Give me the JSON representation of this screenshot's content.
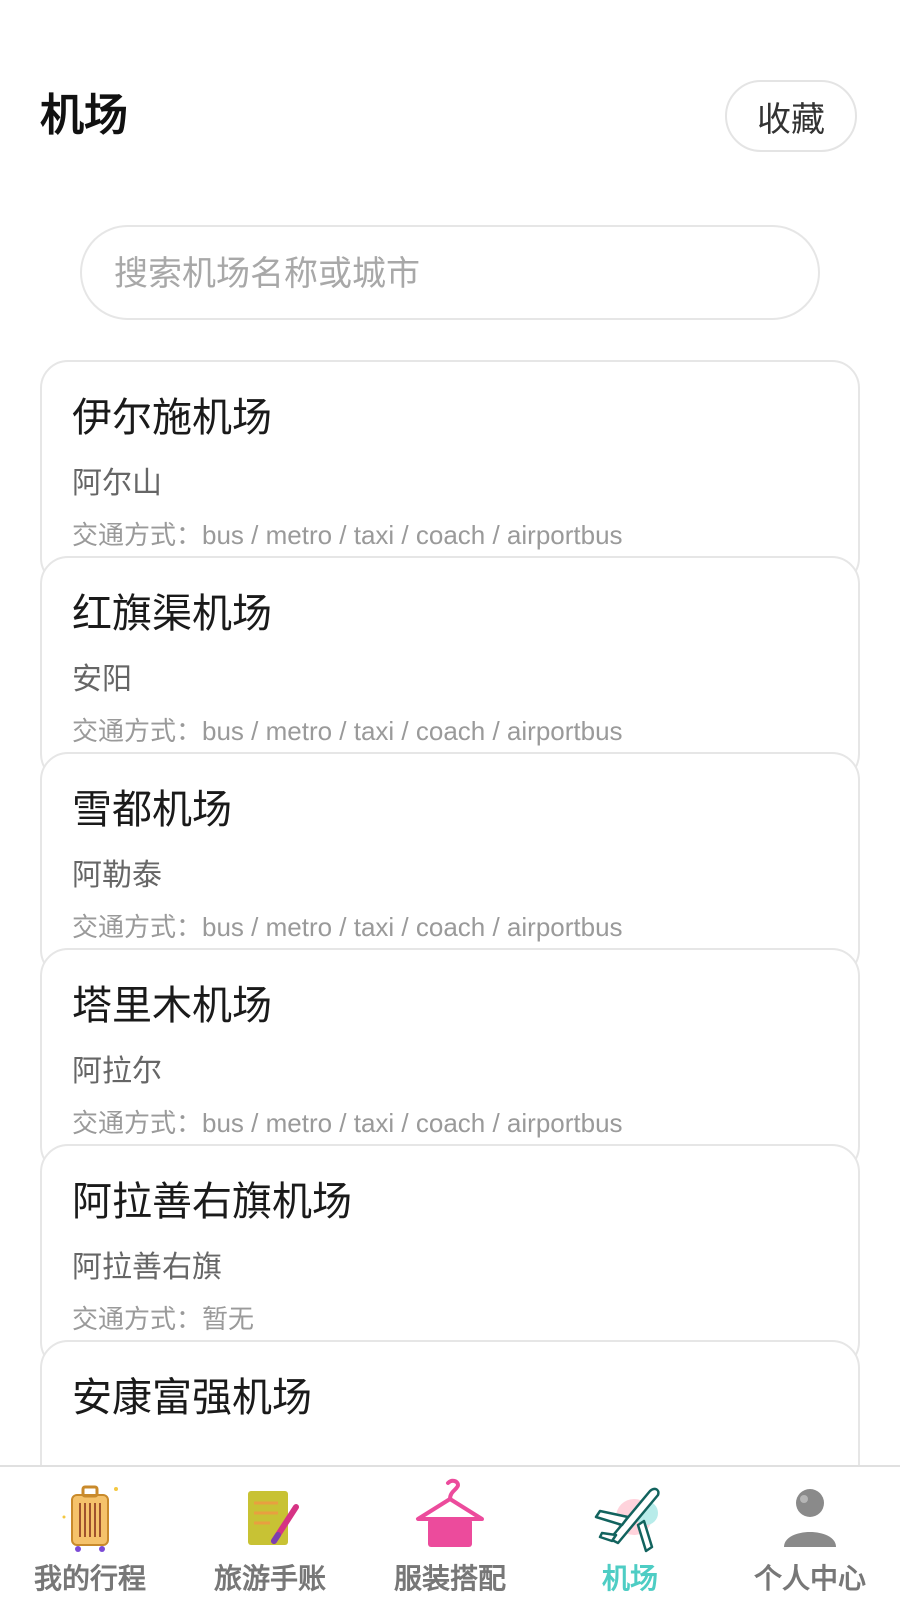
{
  "header": {
    "title": "机场",
    "favorite_label": "收藏"
  },
  "search": {
    "placeholder": "搜索机场名称或城市",
    "value": ""
  },
  "airports": [
    {
      "name": "伊尔施机场",
      "city": "阿尔山",
      "transport_label": "交通方式：",
      "transport": "bus / metro / taxi / coach / airportbus"
    },
    {
      "name": "红旗渠机场",
      "city": "安阳",
      "transport_label": "交通方式：",
      "transport": "bus / metro / taxi / coach / airportbus"
    },
    {
      "name": "雪都机场",
      "city": "阿勒泰",
      "transport_label": "交通方式：",
      "transport": "bus / metro / taxi / coach / airportbus"
    },
    {
      "name": "塔里木机场",
      "city": "阿拉尔",
      "transport_label": "交通方式：",
      "transport": "bus / metro / taxi / coach / airportbus"
    },
    {
      "name": "阿拉善右旗机场",
      "city": "阿拉善右旗",
      "transport_label": "交通方式：",
      "transport": "暂无"
    },
    {
      "name": "安康富强机场",
      "city": "",
      "transport_label": "",
      "transport": ""
    }
  ],
  "tabbar": {
    "items": [
      {
        "label": "我的行程",
        "icon": "luggage-icon",
        "active": false
      },
      {
        "label": "旅游手账",
        "icon": "notebook-icon",
        "active": false
      },
      {
        "label": "服装搭配",
        "icon": "hanger-icon",
        "active": false
      },
      {
        "label": "机场",
        "icon": "airplane-icon",
        "active": true
      },
      {
        "label": "个人中心",
        "icon": "user-icon",
        "active": false
      }
    ],
    "active_color": "#4ecdc4",
    "inactive_color": "#777777"
  }
}
